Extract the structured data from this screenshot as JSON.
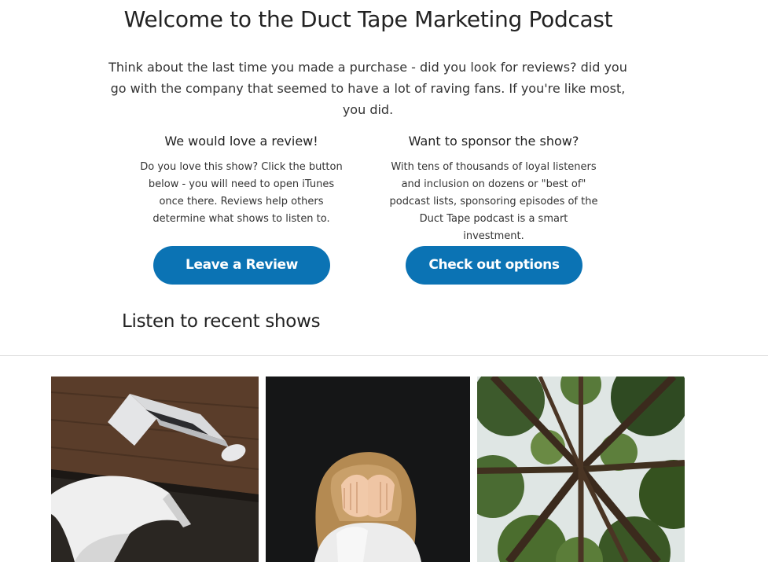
{
  "header": {
    "title": "Welcome to the Duct Tape Marketing Podcast",
    "intro": "Think about the last time you made a purchase - did you look for reviews? did you go with the company that seemed to have a lot of raving fans. If you're like most, you did."
  },
  "review": {
    "heading": "We would love a review!",
    "body": "Do you love this show? Click the button below - you will need to open iTunes once there. Reviews help others determine what shows to listen to.",
    "button_label": "Leave a Review"
  },
  "sponsor": {
    "heading": "Want to sponsor the show?",
    "body": "With tens of thousands of loyal listeners and inclusion on dozens or \"best of\" podcast lists, sponsoring episodes of the Duct Tape podcast is a smart investment.",
    "button_label": "Check out options"
  },
  "recent_shows": {
    "title": "Listen to recent shows",
    "thumbnails": [
      {
        "icon": "laptop-desk-photo"
      },
      {
        "icon": "child-covering-face-photo"
      },
      {
        "icon": "forest-canopy-photo"
      }
    ]
  },
  "colors": {
    "accent": "#0b73b4",
    "text": "#222222",
    "divider": "#dcdcdc"
  }
}
